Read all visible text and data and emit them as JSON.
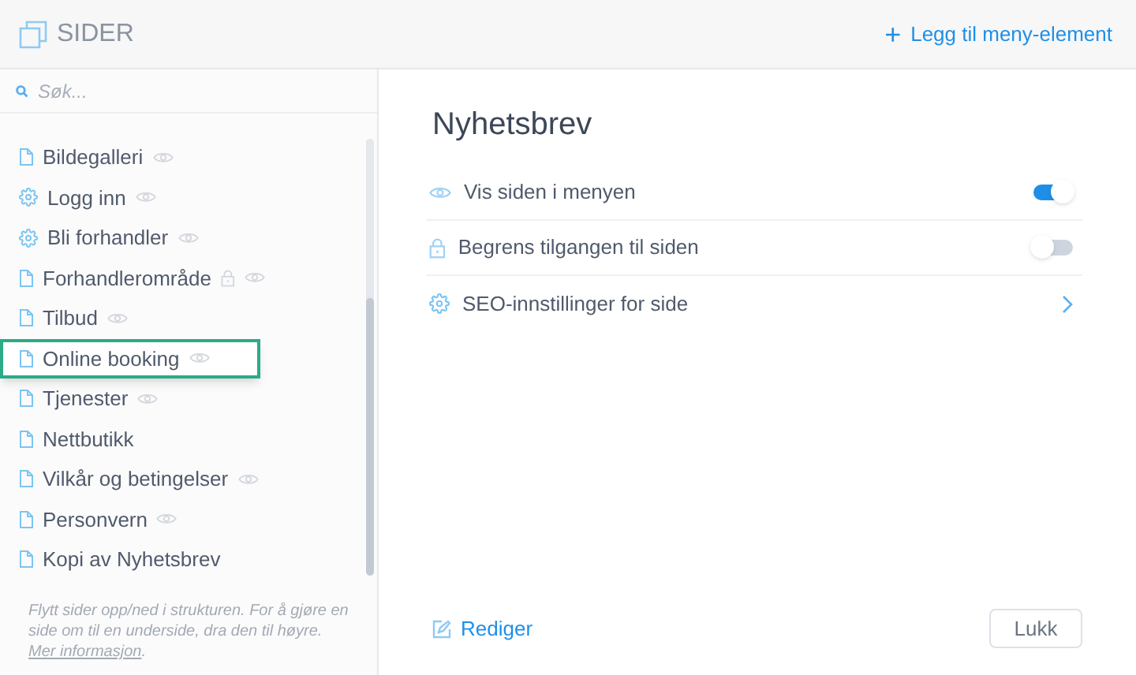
{
  "header": {
    "title": "SIDER",
    "add_link": {
      "icon": "+",
      "label": "Legg til meny-element"
    }
  },
  "search": {
    "placeholder": "Søk..."
  },
  "pages": [
    {
      "label": "Bildegalleri",
      "kind": "page",
      "locked": false,
      "visible": true,
      "selected": false
    },
    {
      "label": "Logg inn",
      "kind": "settings",
      "locked": false,
      "visible": true,
      "selected": false
    },
    {
      "label": "Bli forhandler",
      "kind": "settings",
      "locked": false,
      "visible": true,
      "selected": false
    },
    {
      "label": "Forhandlerområde",
      "kind": "page",
      "locked": true,
      "visible": true,
      "selected": false
    },
    {
      "label": "Tilbud",
      "kind": "page",
      "locked": false,
      "visible": true,
      "selected": false
    },
    {
      "label": "Online booking",
      "kind": "page",
      "locked": false,
      "visible": true,
      "selected": true
    },
    {
      "label": "Tjenester",
      "kind": "page",
      "locked": false,
      "visible": true,
      "selected": false
    },
    {
      "label": "Nettbutikk",
      "kind": "page",
      "locked": false,
      "visible": false,
      "selected": false
    },
    {
      "label": "Vilkår og betingelser",
      "kind": "page",
      "locked": false,
      "visible": true,
      "selected": false
    },
    {
      "label": "Personvern",
      "kind": "page",
      "locked": false,
      "visible": true,
      "selected": false
    },
    {
      "label": "Kopi av Nyhetsbrev",
      "kind": "page",
      "locked": false,
      "visible": false,
      "selected": false
    }
  ],
  "help": {
    "text": "Flytt sider opp/ned i strukturen. For å gjøre en side om til en underside, dra den til høyre.",
    "link": "Mer informasjon",
    "end": "."
  },
  "detail": {
    "title": "Nyhetsbrev",
    "settings": [
      {
        "kind": "visibility",
        "label": "Vis siden i menyen",
        "on": true
      },
      {
        "kind": "access",
        "label": "Begrens tilgangen til siden",
        "on": false
      },
      {
        "kind": "seo",
        "label": "SEO-innstillinger for side"
      }
    ],
    "edit_link": "Rediger",
    "close_button": "Lukk"
  }
}
